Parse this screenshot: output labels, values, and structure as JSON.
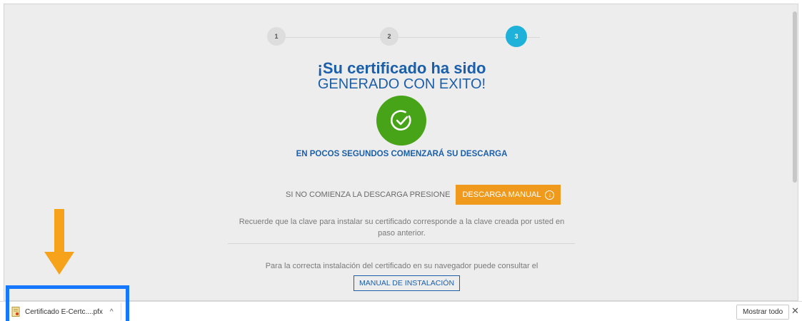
{
  "stepper": {
    "steps": [
      "1",
      "2",
      "3"
    ],
    "active_step": "3"
  },
  "result": {
    "title_strong": "¡Su certificado ha sido",
    "title_sub": "GENERADO CON EXITO!",
    "download_note": "EN POCOS SEGUNDOS COMENZARÁ SU DESCARGA"
  },
  "manual_download": {
    "hint": "SI NO COMIENZA LA DESCARGA PRESIONE",
    "button_label": "DESCARGA MANUAL"
  },
  "reminder_text": "Recuerde que la clave para instalar su certificado corresponde a la clave creada por usted en paso anterior.",
  "install": {
    "text": "Para la correcta instalación del certificado en su navegador puede consultar el",
    "button_label": "MANUAL DE INSTALACIÓN"
  },
  "download_bar": {
    "file_name": "Certificado E-Certc....pfx",
    "show_all_label": "Mostrar todo",
    "close_symbol": "✕",
    "chevron_symbol": "^"
  },
  "colors": {
    "brand_blue": "#1b5faa",
    "step_active": "#1eb1d9",
    "success_green": "#47a317",
    "button_orange": "#f09a1d",
    "annotation_arrow": "#f7a21b",
    "annotation_box": "#1677ff"
  },
  "icons": {
    "success": "check-circle-icon",
    "download": "download-circle-icon",
    "file": "certificate-file-icon",
    "arrow": "arrow-down-icon"
  }
}
